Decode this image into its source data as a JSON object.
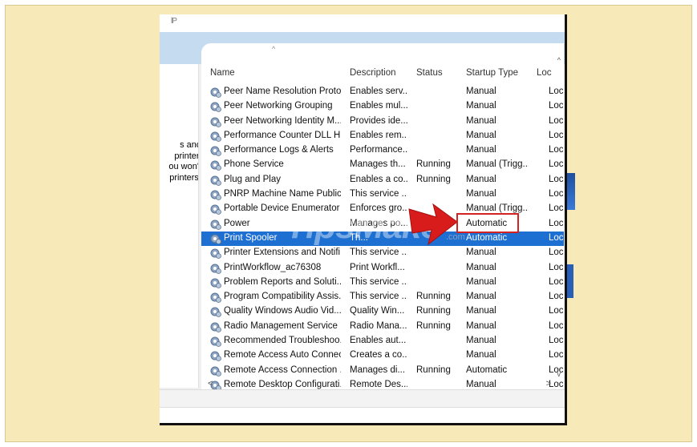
{
  "header": {
    "title_fragment": "lP",
    "sort_indicator": "^"
  },
  "left_panel": {
    "description_lines": [
      "s and",
      "printer.",
      "ou won't",
      "printers."
    ]
  },
  "columns": {
    "name": "Name",
    "description": "Description",
    "status": "Status",
    "startup_type": "Startup Type",
    "log_on_as": "Loc"
  },
  "services": [
    {
      "name": "Peer Name Resolution Proto...",
      "description": "Enables serv...",
      "status": "",
      "startup_type": "Manual",
      "log_on_as": "Loc"
    },
    {
      "name": "Peer Networking Grouping",
      "description": "Enables mul...",
      "status": "",
      "startup_type": "Manual",
      "log_on_as": "Loc"
    },
    {
      "name": "Peer Networking Identity M...",
      "description": "Provides ide...",
      "status": "",
      "startup_type": "Manual",
      "log_on_as": "Loc"
    },
    {
      "name": "Performance Counter DLL H...",
      "description": "Enables rem...",
      "status": "",
      "startup_type": "Manual",
      "log_on_as": "Loc"
    },
    {
      "name": "Performance Logs & Alerts",
      "description": "Performance...",
      "status": "",
      "startup_type": "Manual",
      "log_on_as": "Loc"
    },
    {
      "name": "Phone Service",
      "description": "Manages th...",
      "status": "Running",
      "startup_type": "Manual (Trigg...",
      "log_on_as": "Loc"
    },
    {
      "name": "Plug and Play",
      "description": "Enables a co...",
      "status": "Running",
      "startup_type": "Manual",
      "log_on_as": "Loc"
    },
    {
      "name": "PNRP Machine Name Public...",
      "description": "This service ...",
      "status": "",
      "startup_type": "Manual",
      "log_on_as": "Loc"
    },
    {
      "name": "Portable Device Enumerator ...",
      "description": "Enforces gro...",
      "status": "",
      "startup_type": "Manual (Trigg...",
      "log_on_as": "Loc"
    },
    {
      "name": "Power",
      "description": "Manages po...",
      "status": "Running",
      "startup_type": "Automatic",
      "log_on_as": "Loc"
    },
    {
      "name": "Print Spooler",
      "description": "Th...",
      "status": "",
      "startup_type": "Automatic",
      "log_on_as": "Loc",
      "selected": true
    },
    {
      "name": "Printer Extensions and Notifi...",
      "description": "This service ...",
      "status": "",
      "startup_type": "Manual",
      "log_on_as": "Loc"
    },
    {
      "name": "PrintWorkflow_ac76308",
      "description": "Print Workfl...",
      "status": "",
      "startup_type": "Manual",
      "log_on_as": "Loc"
    },
    {
      "name": "Problem Reports and Soluti...",
      "description": "This service ...",
      "status": "",
      "startup_type": "Manual",
      "log_on_as": "Loc"
    },
    {
      "name": "Program Compatibility Assis...",
      "description": "This service ...",
      "status": "Running",
      "startup_type": "Manual",
      "log_on_as": "Loc"
    },
    {
      "name": "Quality Windows Audio Vid...",
      "description": "Quality Win...",
      "status": "Running",
      "startup_type": "Manual",
      "log_on_as": "Loc"
    },
    {
      "name": "Radio Management Service",
      "description": "Radio Mana...",
      "status": "Running",
      "startup_type": "Manual",
      "log_on_as": "Loc"
    },
    {
      "name": "Recommended Troubleshoo...",
      "description": "Enables aut...",
      "status": "",
      "startup_type": "Manual",
      "log_on_as": "Loc"
    },
    {
      "name": "Remote Access Auto Connec...",
      "description": "Creates a co...",
      "status": "",
      "startup_type": "Manual",
      "log_on_as": "Loc"
    },
    {
      "name": "Remote Access Connection ...",
      "description": "Manages di...",
      "status": "Running",
      "startup_type": "Automatic",
      "log_on_as": "Loc"
    },
    {
      "name": "Remote Desktop Configurati...",
      "description": "Remote Des...",
      "status": "",
      "startup_type": "Manual",
      "log_on_as": "Loc"
    }
  ],
  "scrollbar": {
    "up_arrow": "^",
    "down_arrow": "v",
    "left_arrow": "<",
    "right_arrow": ">"
  },
  "watermark": {
    "text": "TipsMake",
    "suffix": ".com"
  },
  "colors": {
    "selection": "#1d6fd1",
    "highlight_box": "#d32222",
    "arrow": "#d81c1c",
    "background": "#f7e9b8"
  }
}
